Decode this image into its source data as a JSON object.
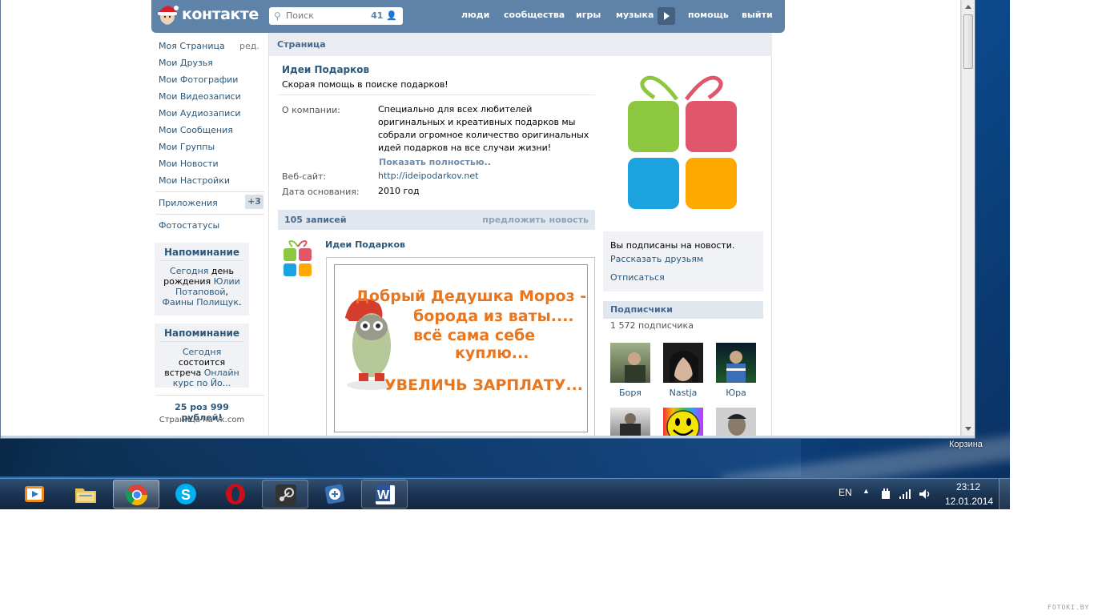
{
  "vk": {
    "logo_text": "контакте",
    "search": {
      "placeholder": "Поиск",
      "count": "41"
    },
    "nav": [
      "люди",
      "сообщества",
      "игры",
      "музыка",
      "помощь",
      "выйти"
    ],
    "left_menu": {
      "items": [
        "Моя Страница",
        "Мои Друзья",
        "Мои Фотографии",
        "Мои Видеозаписи",
        "Мои Аудиозаписи",
        "Мои Сообщения",
        "Мои Группы",
        "Мои Новости",
        "Мои Настройки"
      ],
      "edit_label": "ред.",
      "apps_label": "Приложения",
      "apps_badge": "+3",
      "photostatus_label": "Фотостатусы"
    },
    "reminders": [
      {
        "title": "Напоминание",
        "p1": "Сегодня",
        "p2": " день рождения ",
        "p3": "Юлии Потаповой",
        "p4": ", ",
        "p5": "Фаины Полищук",
        "p6": "."
      },
      {
        "title": "Напоминание",
        "p1": "Сегодня",
        "p2": " состоится встреча ",
        "p3": "Онлайн курс по Йо...",
        "p4": "",
        "p5": "",
        "p6": ""
      }
    ],
    "ad": {
      "title": "25 роз 999 рублей!",
      "subtitle": "Страница на vk.com"
    },
    "page": {
      "bar_title": "Страница",
      "group_name": "Идеи Подарков",
      "status": "Скорая помощь в поиске подарков!",
      "about_label": "О компании:",
      "about_text": "Специально для всех любителей оригинальных и креативных подарков мы собрали огромное количество оригинальных идей подарков на все случаи жизни!",
      "show_more": "Показать полностью..",
      "website_label": "Веб-сайт:",
      "website": "http://ideipodarkov.net",
      "founded_label": "Дата основания:",
      "founded": "2010 год",
      "wall_count": "105 записей",
      "suggest_news": "предложить новость",
      "post_author": "Идеи Подарков",
      "post_image_lines": [
        "Добрый Дедушка Мороз -",
        "борода из ваты....",
        "всё сама себе",
        "куплю...",
        "УВЕЛИЧЬ ЗАРПЛАТУ..."
      ]
    },
    "right": {
      "subscribed_text": "Вы подписаны на новости.",
      "tell_friends": "Рассказать друзьям",
      "unsubscribe": "Отписаться",
      "subscribers_title": "Подписчики",
      "subscribers_count": "1 572 подписчика",
      "subscribers": [
        "Боря",
        "Nastja",
        "Юра"
      ]
    }
  },
  "desktop": {
    "recycle_bin": "Корзина"
  },
  "taskbar": {
    "apps": [
      "media-player-icon",
      "explorer-icon",
      "chrome-icon",
      "skype-icon",
      "opera-icon",
      "steam-icon",
      "notepad-app-icon",
      "word-icon"
    ],
    "lang": "EN",
    "time": "23:12",
    "date": "12.01.2014"
  },
  "watermark": "FOTOKI.BY"
}
